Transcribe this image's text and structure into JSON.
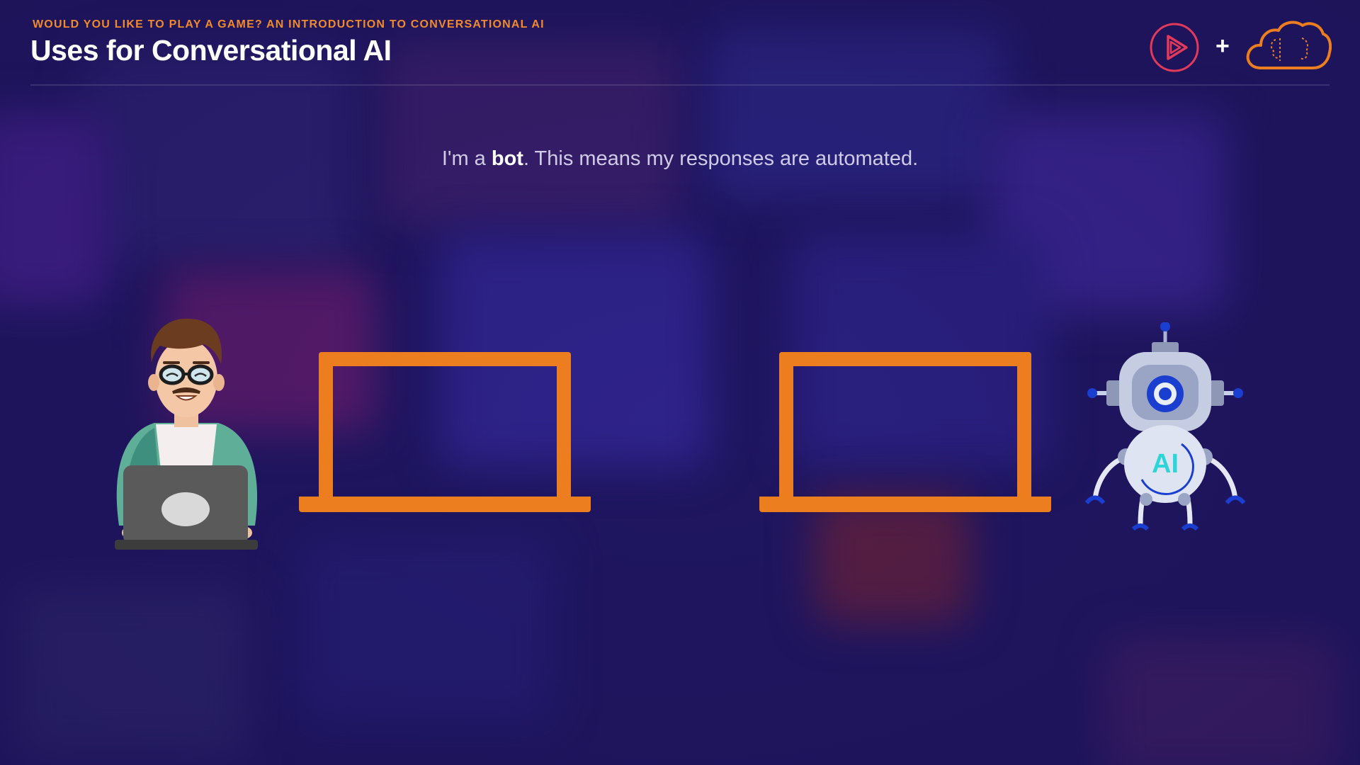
{
  "header": {
    "kicker": "WOULD YOU LIKE TO PLAY A GAME? AN INTRODUCTION TO CONVERSATIONAL AI",
    "title": "Uses for Conversational AI",
    "logo_separator": "+"
  },
  "caption": {
    "prefix": "I'm a ",
    "emphasis": "bot",
    "suffix": ". This means my responses are automated."
  },
  "robot": {
    "chest_label": "AI"
  },
  "icons": {
    "play_logo": "play-circle-icon",
    "cloud_logo": "cloud-brain-icon"
  },
  "colors": {
    "accent": "#ec7e20",
    "background": "#1f1660",
    "kicker": "#f08a2c",
    "play_logo": "#e23a5a"
  }
}
